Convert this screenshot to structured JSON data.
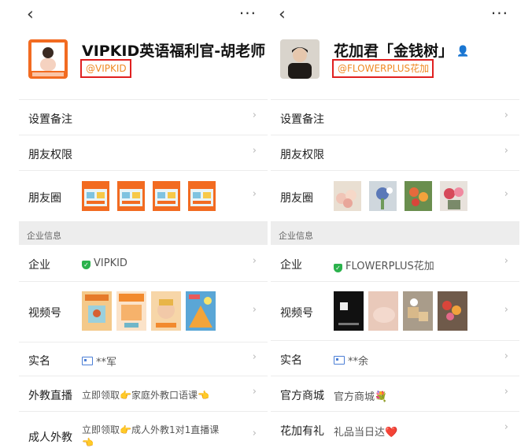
{
  "left": {
    "back_icon": "‹",
    "more_icon": "···",
    "name": "VIPKID英语福利官-胡老师",
    "name_badge": "👤",
    "handle": "@VIPKID",
    "rows": {
      "remark": "设置备注",
      "permissions": "朋友权限",
      "moments": "朋友圈"
    },
    "section_title": "企业信息",
    "company_label": "企业",
    "company_value": "VIPKID",
    "channels_label": "视频号",
    "realname_label": "实名",
    "realname_value": "**军",
    "live_label": "外教直播",
    "live_value": "立即领取👉家庭外教口语课👈",
    "adult_label": "成人外教",
    "adult_value_line1": "立即领取👉成人外教1对1直播课",
    "adult_value_line2": "👈",
    "chevron": "›"
  },
  "right": {
    "back_icon": "‹",
    "more_icon": "···",
    "name": "花加君「金钱树」",
    "name_badge": "👤",
    "handle": "@FLOWERPLUS花加",
    "rows": {
      "remark": "设置备注",
      "permissions": "朋友权限",
      "moments": "朋友圈"
    },
    "section_title": "企业信息",
    "company_label": "企业",
    "company_value": "FLOWERPLUS花加",
    "channels_label": "视频号",
    "realname_label": "实名",
    "realname_value": "**余",
    "mall_label": "官方商城",
    "mall_value": "官方商城💐",
    "gift_label": "花加有礼",
    "gift_value": "礼品当日达❤️",
    "chevron": "›"
  },
  "colors": {
    "handle_border": "#e02020",
    "handle_text": "#f08a24",
    "section_bg": "#ededed",
    "verified": "#2bb24c",
    "vipkid_orange": "#f26b21"
  }
}
